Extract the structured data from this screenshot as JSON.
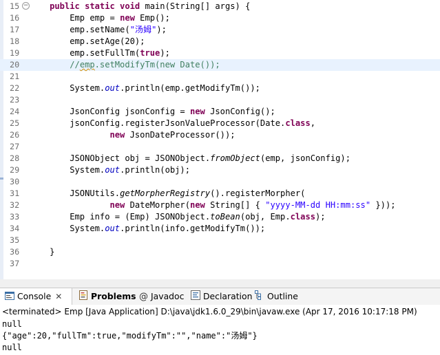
{
  "editor": {
    "lines": [
      {
        "n": "15",
        "parts": [
          [
            "    ",
            ""
          ],
          [
            "public static void",
            "kw"
          ],
          [
            " main(String[] args) {",
            ""
          ]
        ]
      },
      {
        "n": "16",
        "parts": [
          [
            "        Emp emp = ",
            ""
          ],
          [
            "new",
            "kw"
          ],
          [
            " Emp();",
            ""
          ]
        ]
      },
      {
        "n": "17",
        "parts": [
          [
            "        emp.setName(",
            ""
          ],
          [
            "\"汤姆\"",
            "str"
          ],
          [
            ");",
            ""
          ]
        ]
      },
      {
        "n": "18",
        "parts": [
          [
            "        emp.setAge(20);",
            ""
          ]
        ]
      },
      {
        "n": "19",
        "parts": [
          [
            "        emp.setFullTm(",
            ""
          ],
          [
            "true",
            "kw"
          ],
          [
            ");",
            ""
          ]
        ]
      },
      {
        "n": "20",
        "parts": [
          [
            "        //",
            "cmt"
          ],
          [
            "emp",
            "cmt squiggle"
          ],
          [
            ".setModifyTm(new Date());",
            "cmt"
          ]
        ]
      },
      {
        "n": "21",
        "parts": []
      },
      {
        "n": "22",
        "parts": [
          [
            "        System.",
            ""
          ],
          [
            "out",
            "fld"
          ],
          [
            ".println(emp.getModifyTm());",
            ""
          ]
        ]
      },
      {
        "n": "23",
        "parts": []
      },
      {
        "n": "24",
        "parts": [
          [
            "        JsonConfig jsonConfig = ",
            ""
          ],
          [
            "new",
            "kw"
          ],
          [
            " JsonConfig();",
            ""
          ]
        ]
      },
      {
        "n": "25",
        "parts": [
          [
            "        jsonConfig.registerJsonValueProcessor(Date.",
            ""
          ],
          [
            "class",
            "kw"
          ],
          [
            ",",
            ""
          ]
        ]
      },
      {
        "n": "26",
        "parts": [
          [
            "                ",
            ""
          ],
          [
            "new",
            "kw"
          ],
          [
            " JsonDateProcessor());",
            ""
          ]
        ]
      },
      {
        "n": "27",
        "parts": []
      },
      {
        "n": "28",
        "parts": [
          [
            "        JSONObject obj = JSONObject.",
            ""
          ],
          [
            "fromObject",
            "ital"
          ],
          [
            "(emp, jsonConfig);",
            ""
          ]
        ]
      },
      {
        "n": "29",
        "parts": [
          [
            "        System.",
            ""
          ],
          [
            "out",
            "fld"
          ],
          [
            ".println(obj);",
            ""
          ]
        ]
      },
      {
        "n": "30",
        "parts": []
      },
      {
        "n": "31",
        "parts": [
          [
            "        JSONUtils.",
            ""
          ],
          [
            "getMorpherRegistry",
            "ital"
          ],
          [
            "().registerMorpher(",
            ""
          ]
        ]
      },
      {
        "n": "32",
        "parts": [
          [
            "                ",
            ""
          ],
          [
            "new",
            "kw"
          ],
          [
            " DateMorpher(",
            ""
          ],
          [
            "new",
            "kw"
          ],
          [
            " String[] { ",
            ""
          ],
          [
            "\"yyyy-MM-dd HH:mm:ss\"",
            "str"
          ],
          [
            " }));",
            ""
          ]
        ]
      },
      {
        "n": "33",
        "parts": [
          [
            "        Emp info = (Emp) JSONObject.",
            ""
          ],
          [
            "toBean",
            "ital"
          ],
          [
            "(obj, Emp.",
            ""
          ],
          [
            "class",
            "kw"
          ],
          [
            ");",
            ""
          ]
        ]
      },
      {
        "n": "34",
        "parts": [
          [
            "        System.",
            ""
          ],
          [
            "out",
            "fld"
          ],
          [
            ".println(info.getModifyTm());",
            ""
          ]
        ]
      },
      {
        "n": "35",
        "parts": []
      },
      {
        "n": "36",
        "parts": [
          [
            "    }",
            ""
          ]
        ]
      },
      {
        "n": "37",
        "parts": []
      }
    ],
    "current_line": "20",
    "fold_marker": "−"
  },
  "tabs": {
    "console": "Console",
    "console_close": "✕",
    "problems": "Problems",
    "javadoc": "Javadoc",
    "declaration": "Declaration",
    "outline": "Outline"
  },
  "console": {
    "header": "<terminated> Emp [Java Application] D:\\java\\jdk1.6.0_29\\bin\\javaw.exe (Apr 17, 2016 10:17:18 PM)",
    "output": [
      "null",
      "{\"age\":20,\"fullTm\":true,\"modifyTm\":\"\",\"name\":\"汤姆\"}",
      "null"
    ]
  }
}
